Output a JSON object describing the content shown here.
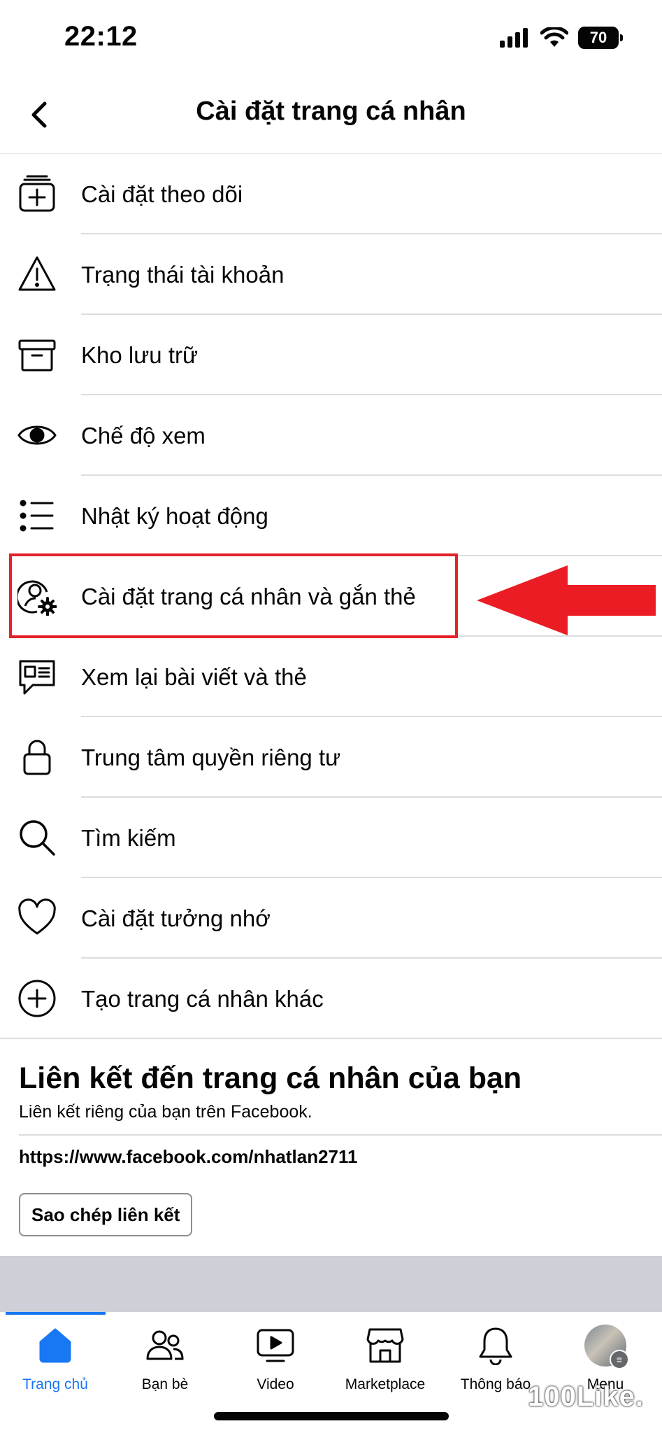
{
  "status_bar": {
    "time": "22:12",
    "battery": "70"
  },
  "header": {
    "title": "Cài đặt trang cá nhân",
    "back_icon": "chevron-left-icon"
  },
  "menu": {
    "items": [
      {
        "label": "Cài đặt theo dõi",
        "icon": "follow-settings-icon"
      },
      {
        "label": "Trạng thái tài khoản",
        "icon": "warning-icon"
      },
      {
        "label": "Kho lưu trữ",
        "icon": "archive-icon"
      },
      {
        "label": "Chế độ xem",
        "icon": "eye-icon"
      },
      {
        "label": "Nhật ký hoạt động",
        "icon": "list-icon"
      },
      {
        "label": "Cài đặt trang cá nhân và gắn thẻ",
        "icon": "profile-gear-icon"
      },
      {
        "label": "Xem lại bài viết và thẻ",
        "icon": "review-chat-icon"
      },
      {
        "label": "Trung tâm quyền riêng tư",
        "icon": "lock-icon"
      },
      {
        "label": "Tìm kiếm",
        "icon": "search-icon"
      },
      {
        "label": "Cài đặt tưởng nhớ",
        "icon": "heart-icon"
      },
      {
        "label": "Tạo trang cá nhân khác",
        "icon": "add-circle-icon"
      }
    ],
    "highlight_color": "#e3222a"
  },
  "profile_link": {
    "title": "Liên kết đến trang cá nhân của bạn",
    "subtitle": "Liên kết riêng của bạn trên Facebook.",
    "url": "https://www.facebook.com/nhatlan2711",
    "copy_button": "Sao chép liên kết"
  },
  "tab_bar": {
    "active_color": "#1877f2",
    "tabs": [
      {
        "label": "Trang chủ",
        "icon": "home-icon"
      },
      {
        "label": "Bạn bè",
        "icon": "friends-icon"
      },
      {
        "label": "Video",
        "icon": "video-icon"
      },
      {
        "label": "Marketplace",
        "icon": "marketplace-icon"
      },
      {
        "label": "Thông báo",
        "icon": "bell-icon"
      },
      {
        "label": "Menu",
        "icon": "avatar"
      }
    ]
  },
  "watermark": "100Like."
}
